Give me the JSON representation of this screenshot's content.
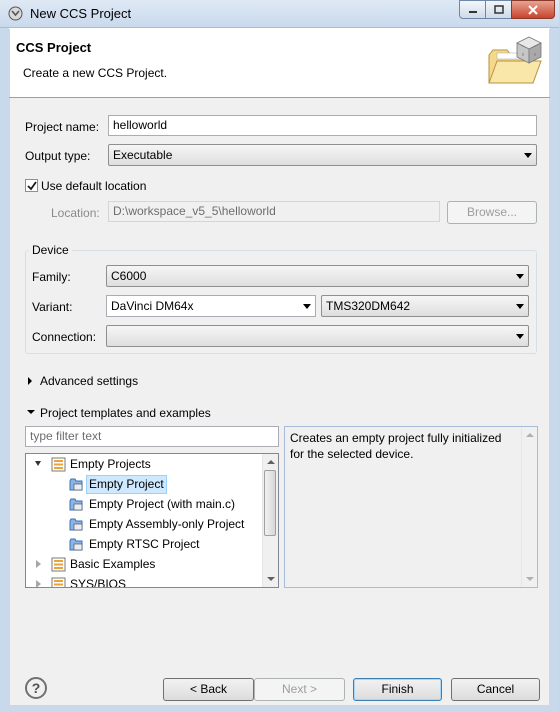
{
  "window": {
    "title": "New CCS Project",
    "minimize_glyph": "▭",
    "maximize_glyph": "□",
    "close_glyph": "✕"
  },
  "banner": {
    "title": "CCS Project",
    "description": "Create a new CCS Project.",
    "icon": "folder-with-cube-icon"
  },
  "project": {
    "name_label": "Project name:",
    "name_value": "helloworld",
    "output_label": "Output type:",
    "output_value": "Executable",
    "use_default_label": "Use default location",
    "use_default_checked": true,
    "location_label": "Location:",
    "location_value": "D:\\workspace_v5_5\\helloworld",
    "browse_label": "Browse..."
  },
  "device": {
    "group_label": "Device",
    "family_label": "Family:",
    "family_value": "C6000",
    "variant_label": "Variant:",
    "variant_filter": "DaVinci DM64x",
    "variant_value": "TMS320DM642",
    "connection_label": "Connection:",
    "connection_value": ""
  },
  "sections": {
    "advanced": "Advanced settings",
    "templates": "Project templates and examples"
  },
  "templates": {
    "filter_placeholder": "type filter text",
    "items": [
      {
        "label": "Empty Projects",
        "expanded": true,
        "icon": "folder-list-icon"
      },
      {
        "label": "Empty Project",
        "selected": true,
        "icon": "project-icon"
      },
      {
        "label": "Empty Project (with main.c)",
        "icon": "project-icon"
      },
      {
        "label": "Empty Assembly-only Project",
        "icon": "project-icon"
      },
      {
        "label": "Empty RTSC Project",
        "icon": "project-icon"
      },
      {
        "label": "Basic Examples",
        "expanded": false,
        "icon": "folder-list-icon"
      },
      {
        "label": "SYS/BIOS",
        "expanded": false,
        "icon": "folder-list-icon"
      }
    ],
    "description": "Creates an empty project fully initialized for the selected device."
  },
  "footer": {
    "help": "?",
    "back": "< Back",
    "next": "Next >",
    "finish": "Finish",
    "cancel": "Cancel"
  }
}
